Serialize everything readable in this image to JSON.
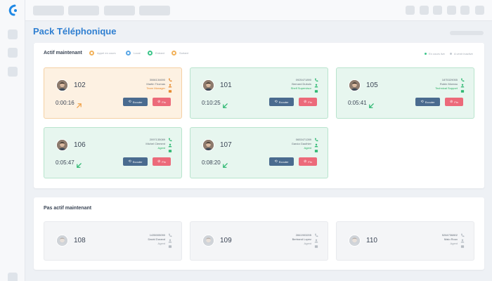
{
  "app": {
    "title": "Pack Téléphonique"
  },
  "sections": {
    "active": {
      "title": "Actif maintenant"
    },
    "inactive": {
      "title": "Pas actif maintenant"
    }
  },
  "legend": {
    "items": [
      {
        "label": "Appel en cours",
        "color": "#f2b25b"
      },
      {
        "label": "Local",
        "color": "#5aa7e6"
      },
      {
        "label": "Entrant",
        "color": "#3cc58a"
      },
      {
        "label": "Sortant",
        "color": "#f2b25b"
      }
    ],
    "right": [
      {
        "label": "En cours live",
        "color": "#3cc58a"
      },
      {
        "label": "A venir inactive",
        "color": "#c4cad1"
      }
    ]
  },
  "buttons": {
    "listen": "Ecouter",
    "end": "Fin"
  },
  "active_cards": [
    {
      "ext": "102",
      "phone": "3066134690",
      "name": "Martin Thomas",
      "role": "Team Manager",
      "timer": "0:00:16",
      "direction": "outgoing",
      "state": "orange"
    },
    {
      "ext": "101",
      "phone": "0925471890",
      "name": "Bernard Dubois",
      "role": "Shelf Supervisor",
      "timer": "0:10:25",
      "direction": "incoming",
      "state": "green"
    },
    {
      "ext": "105",
      "phone": "1875329055",
      "name": "Robin Moreau",
      "role": "Technical Support",
      "timer": "0:05:41",
      "direction": "incoming",
      "state": "green"
    },
    {
      "ext": "106",
      "phone": "2097135089",
      "name": "Michel Clement",
      "role": "Agent",
      "timer": "0:05:47",
      "direction": "incoming",
      "state": "green"
    },
    {
      "ext": "107",
      "phone": "0653471289",
      "name": "Garcia Gauthier",
      "role": "Agent",
      "timer": "0:08:20",
      "direction": "incoming",
      "state": "green"
    }
  ],
  "inactive_cards": [
    {
      "ext": "108",
      "phone": "1435005090",
      "name": "David Durand",
      "role": "Agent"
    },
    {
      "ext": "109",
      "phone": "2841903205",
      "name": "Bertrand Lopez",
      "role": "Agent"
    },
    {
      "ext": "110",
      "phone": "5264736802",
      "name": "Malo Roux",
      "role": "Agent"
    }
  ]
}
